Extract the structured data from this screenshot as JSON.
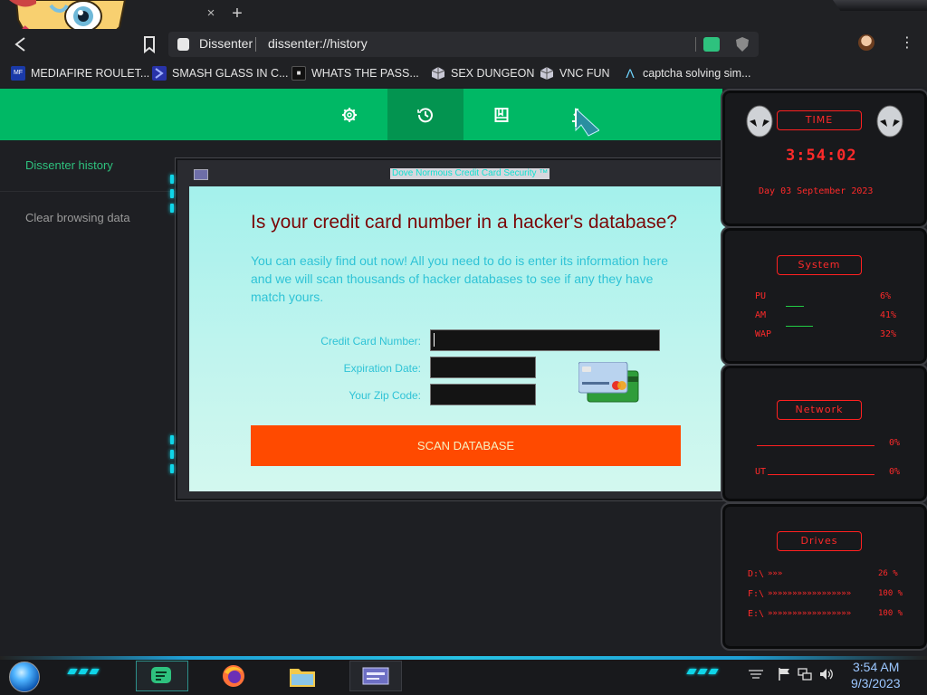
{
  "browser": {
    "tab_close": "×",
    "tab_new": "+",
    "site_name": "Dissenter",
    "url": "dissenter://history",
    "menu_icon": "⋮",
    "bookmarks": [
      {
        "label": "MEDIAFIRE ROULET...",
        "icon": "mediafire-icon"
      },
      {
        "label": "SMASH GLASS IN C...",
        "icon": "chevron-icon"
      },
      {
        "label": "WHATS THE PASS...",
        "icon": "terminal-icon"
      },
      {
        "label": "SEX DUNGEON",
        "icon": "cube-icon"
      },
      {
        "label": "VNC FUN",
        "icon": "cube-icon"
      },
      {
        "label": "captcha solving sim...",
        "icon": "a-logo-icon"
      }
    ],
    "bookmark_icon_glyphs": {
      "mediafire": "MF",
      "terminal": "■",
      "a_logo": "Λ"
    }
  },
  "dissenter": {
    "nav_tabs": [
      "settings",
      "history",
      "bookmarks",
      "downloads"
    ],
    "active_tab": "history",
    "sidebar": {
      "history_label": "Dissenter history",
      "clear_label": "Clear browsing data"
    }
  },
  "popup": {
    "title": "Dove Normous Credit Card Security ™",
    "heading": "Is your credit card number in a hacker's database?",
    "intro": "You can easily find out now! All you need to do is enter its information here and we will scan thousands of hacker databases to see if any they have match yours.",
    "fields": {
      "card_number_label": "Credit Card Number:",
      "expiration_label": "Expiration Date:",
      "zip_label": "Your Zip Code:"
    },
    "scan_button": "SCAN DATABASE"
  },
  "gadgets": {
    "time": {
      "badge": "TIME",
      "clock": "3:54:02",
      "date": "Day 03 September 2023"
    },
    "system": {
      "badge": "System",
      "rows": [
        {
          "label": "PU",
          "value": "6%"
        },
        {
          "label": "AM",
          "value": "41%"
        },
        {
          "label": "WAP",
          "value": "32%"
        }
      ]
    },
    "network": {
      "badge": "Network",
      "rows": [
        {
          "label": "",
          "value": "0%"
        },
        {
          "label": "UT",
          "value": "0%"
        }
      ]
    },
    "drives": {
      "badge": "Drives",
      "rows": [
        {
          "label": "D:\\",
          "arrows": "»»»",
          "value": "26 %",
          "level": 0.26
        },
        {
          "label": "F:\\",
          "arrows": "»»»»»»»»»»»»»»»»»",
          "value": "100 %",
          "level": 1.0
        },
        {
          "label": "E:\\",
          "arrows": "»»»»»»»»»»»»»»»»»",
          "value": "100 %",
          "level": 1.0
        }
      ]
    }
  },
  "taskbar": {
    "clock_time": "3:54 AM",
    "clock_date": "9/3/2023",
    "apps": [
      "dissenter-icon",
      "firefox-icon",
      "file-explorer-icon",
      "app-window-icon"
    ]
  },
  "colors": {
    "accent_green": "#00b865",
    "active_green": "#039450",
    "scan_button": "#ff4a00",
    "heading": "#7b0707",
    "gadget_red": "#ff2a2a",
    "led_cyan": "#0fd5e8"
  }
}
